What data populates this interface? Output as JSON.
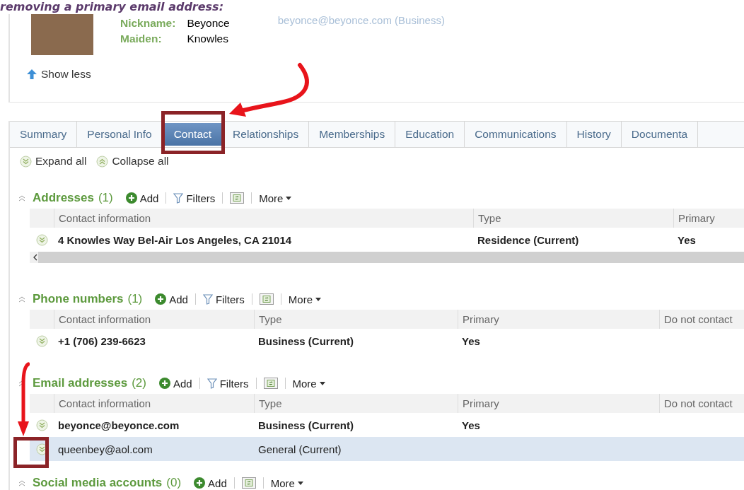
{
  "heading": "removing a primary email address:",
  "profile": {
    "fields": [
      {
        "label": "Nickname:",
        "value": "Beyonce"
      },
      {
        "label": "Maiden:",
        "value": "Knowles"
      }
    ],
    "email": "beyonce@beyonce.com (Business)",
    "show_less": "Show less"
  },
  "tabs": [
    {
      "label": "Summary",
      "selected": false
    },
    {
      "label": "Personal Info",
      "selected": false
    },
    {
      "label": "Contact",
      "selected": true
    },
    {
      "label": "Relationships",
      "selected": false
    },
    {
      "label": "Memberships",
      "selected": false
    },
    {
      "label": "Education",
      "selected": false
    },
    {
      "label": "Communications",
      "selected": false
    },
    {
      "label": "History",
      "selected": false
    },
    {
      "label": "Documenta",
      "selected": false
    }
  ],
  "expand_all": "Expand all",
  "collapse_all": "Collapse all",
  "sections": [
    {
      "title": "Addresses",
      "count": "(1)",
      "actions": [
        {
          "kind": "add",
          "label": "Add"
        },
        {
          "kind": "filter",
          "label": "Filters"
        },
        {
          "kind": "refresh"
        },
        {
          "kind": "more",
          "label": "More"
        }
      ],
      "columns": [
        "Contact information",
        "Type",
        "Primary"
      ],
      "rows": [
        {
          "cells": [
            "4 Knowles Way Bel-Air Los Angeles, CA 21014",
            "Residence (Current)",
            "Yes"
          ],
          "selected": false
        }
      ],
      "scrollbar": true
    },
    {
      "title": "Phone numbers",
      "count": "(1)",
      "actions": [
        {
          "kind": "add",
          "label": "Add"
        },
        {
          "kind": "filter",
          "label": "Filters"
        },
        {
          "kind": "refresh"
        },
        {
          "kind": "more",
          "label": "More"
        }
      ],
      "columns": [
        "Contact information",
        "Type",
        "Primary",
        "Do not contact"
      ],
      "rows": [
        {
          "cells": [
            "+1 (706) 239-6623",
            "Business (Current)",
            "Yes"
          ],
          "selected": false
        }
      ]
    },
    {
      "title": "Email addresses",
      "count": "(2)",
      "actions": [
        {
          "kind": "add",
          "label": "Add"
        },
        {
          "kind": "filter",
          "label": "Filters"
        },
        {
          "kind": "refresh"
        },
        {
          "kind": "more",
          "label": "More"
        }
      ],
      "columns": [
        "Contact information",
        "Type",
        "Primary",
        "Do not contact"
      ],
      "rows": [
        {
          "cells": [
            "beyonce@beyonce.com",
            "Business (Current)",
            "Yes"
          ],
          "selected": false
        },
        {
          "cells": [
            "queenbey@aol.com",
            "General (Current)"
          ],
          "selected": true
        }
      ]
    },
    {
      "title": "Social media accounts",
      "count": "(0)",
      "actions": [
        {
          "kind": "add",
          "label": "Add"
        },
        {
          "kind": "refresh"
        },
        {
          "kind": "more",
          "label": "More"
        }
      ]
    }
  ]
}
